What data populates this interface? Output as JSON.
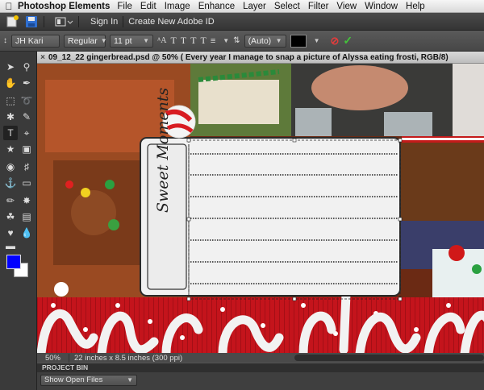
{
  "menubar": {
    "app_name": "Photoshop Elements",
    "items": [
      "File",
      "Edit",
      "Image",
      "Enhance",
      "Layer",
      "Select",
      "Filter",
      "View",
      "Window",
      "Help"
    ]
  },
  "topbar": {
    "sign_in": "Sign In",
    "create_id": "Create New Adobe ID"
  },
  "options": {
    "font_family": "JH Kari",
    "font_style": "Regular",
    "font_size": "11 pt",
    "leading": "(Auto)",
    "text_color": "#000000"
  },
  "document": {
    "tab_title": "09_12_22 gingerbread.psd @ 50% ( Every year I manage to snap a picture of Alyssa eating frosti, RGB/8)",
    "journal_text": "Sweet Moments"
  },
  "colors": {
    "foreground": "#0000ff",
    "background": "#ffffff"
  },
  "status": {
    "zoom": "50%",
    "dimensions": "22 inches x 8.5 inches (300 ppi)"
  },
  "bin": {
    "header": "PROJECT BIN",
    "dropdown_value": "Show Open Files"
  },
  "icons": [
    "apple-icon",
    "new-icon",
    "save-icon",
    "layout-icon",
    "text-anti-alias-icon",
    "cancel-icon",
    "commit-icon"
  ]
}
